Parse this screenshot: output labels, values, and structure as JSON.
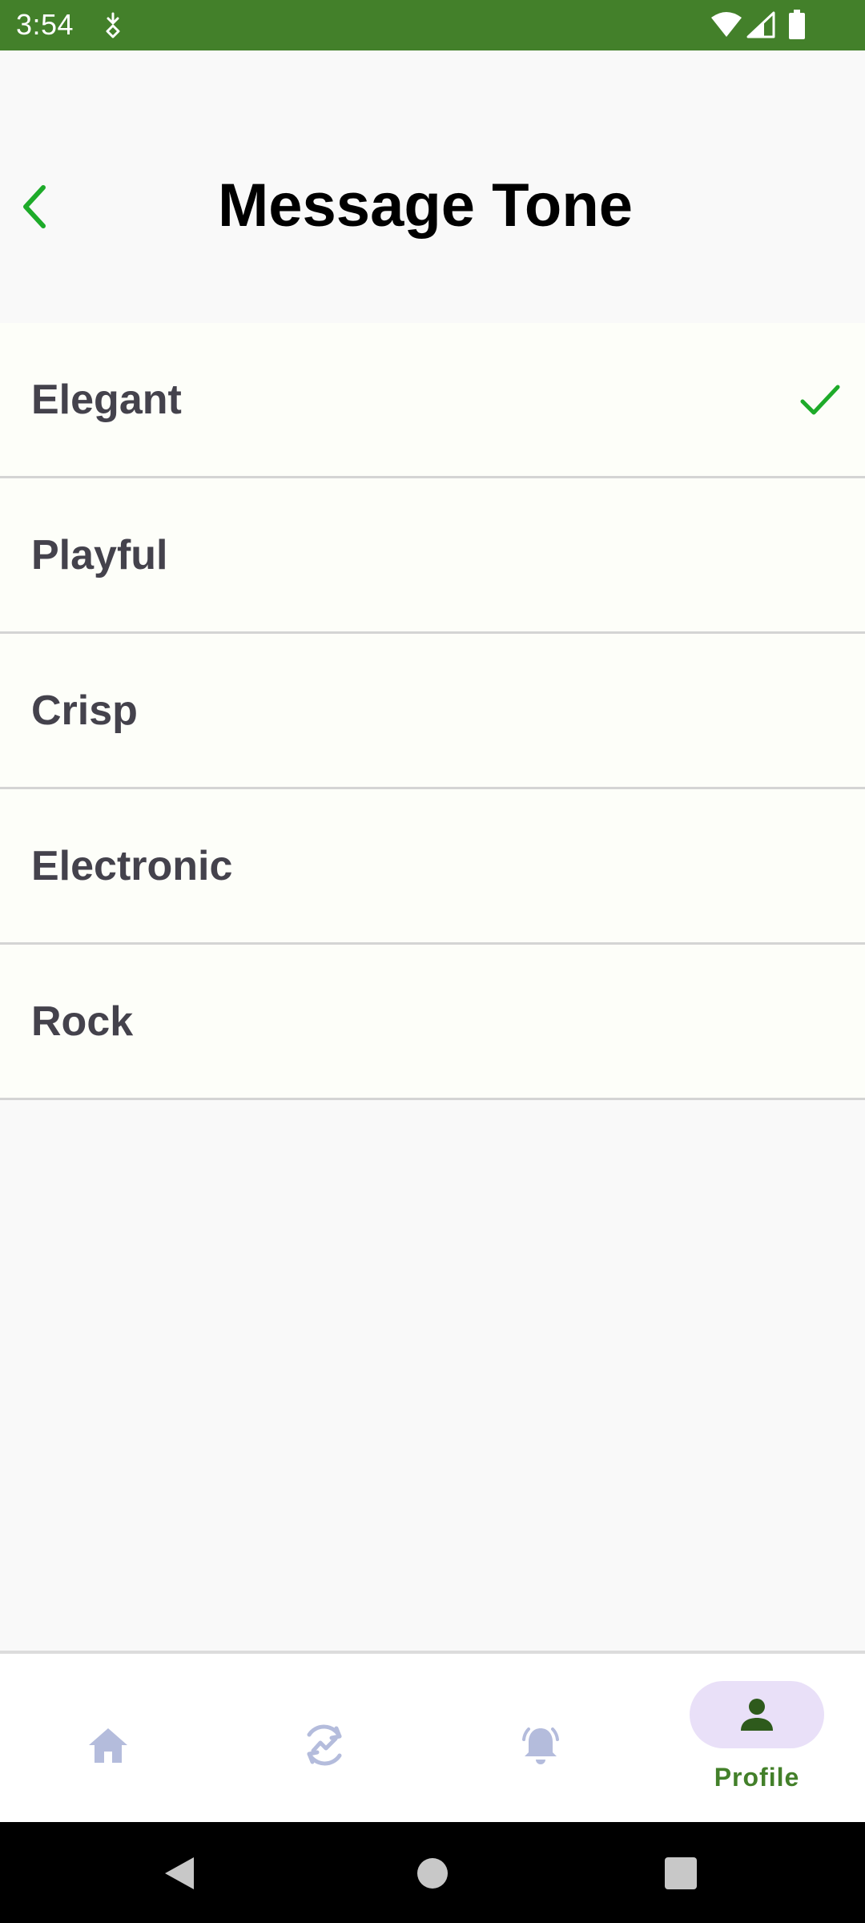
{
  "status_bar": {
    "time": "3:54",
    "icons": [
      "download-activity-icon",
      "wifi-icon",
      "cell-signal-icon",
      "battery-icon"
    ]
  },
  "header": {
    "title": "Message Tone",
    "back_icon": "chevron-left-icon"
  },
  "tones": [
    {
      "label": "Elegant",
      "selected": true
    },
    {
      "label": "Playful",
      "selected": false
    },
    {
      "label": "Crisp",
      "selected": false
    },
    {
      "label": "Electronic",
      "selected": false
    },
    {
      "label": "Rock",
      "selected": false
    }
  ],
  "bottom_nav": {
    "items": [
      {
        "icon": "home-icon",
        "label": "",
        "active": false
      },
      {
        "icon": "activity-sync-icon",
        "label": "",
        "active": false
      },
      {
        "icon": "bell-icon",
        "label": "",
        "active": false
      },
      {
        "icon": "person-icon",
        "label": "Profile",
        "active": true
      }
    ]
  },
  "system_nav": {
    "icons": [
      "back-triangle-icon",
      "home-circle-icon",
      "recents-square-icon"
    ]
  },
  "colors": {
    "brand_green": "#43802a",
    "check_green": "#1eab2a",
    "label_gray": "#44424c",
    "nav_inactive": "#b4bcdc",
    "nav_active_pill": "#e9e0f8"
  }
}
